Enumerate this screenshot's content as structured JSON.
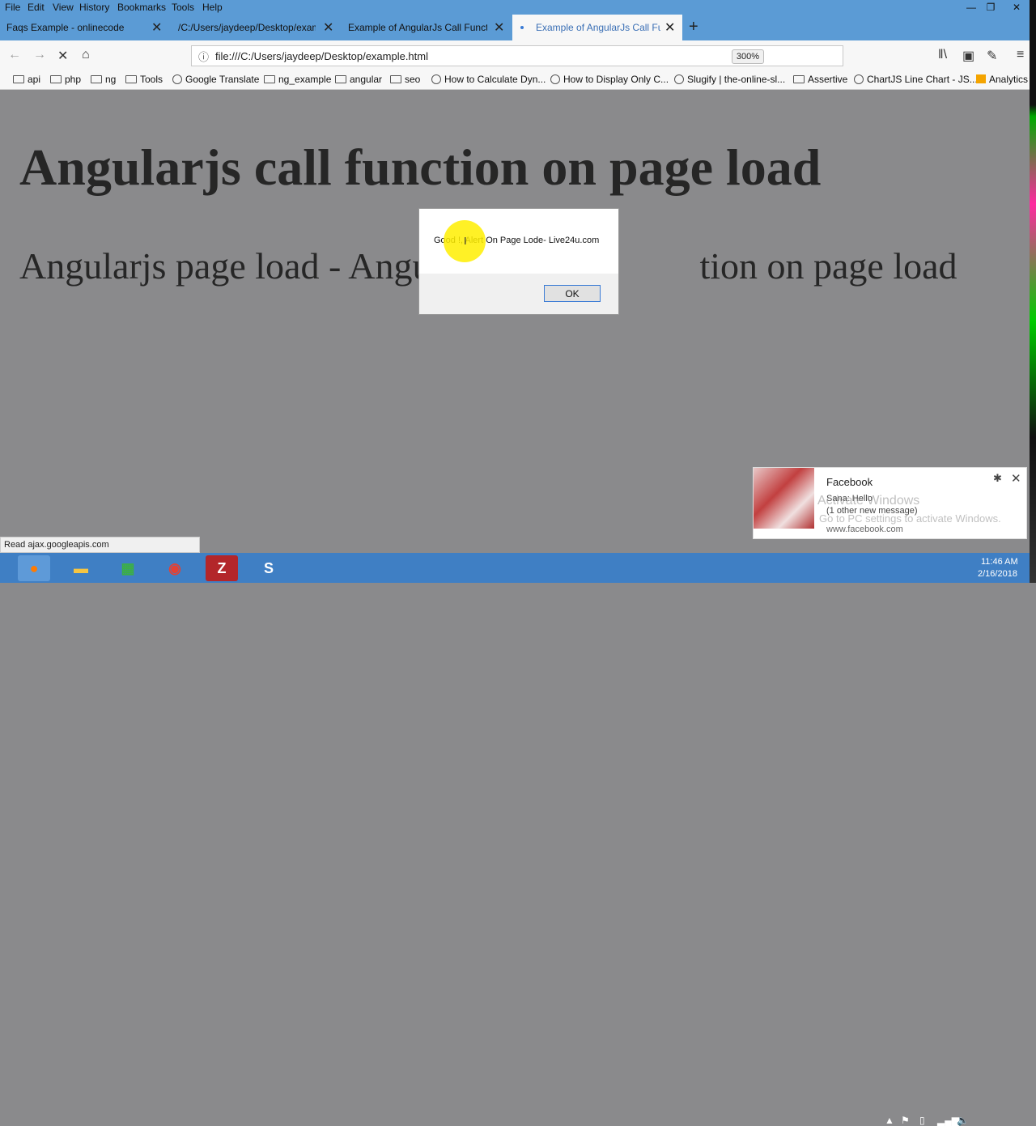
{
  "menu": {
    "items": [
      "File",
      "Edit",
      "View",
      "History",
      "Bookmarks",
      "Tools",
      "Help"
    ]
  },
  "tabs": [
    {
      "label": "Faqs Example - onlinecode"
    },
    {
      "label": "/C:/Users/jaydeep/Desktop/examp"
    },
    {
      "label": "Example of AngularJs Call Function"
    },
    {
      "label": "Example of AngularJs Call Func"
    }
  ],
  "toolbar": {
    "url": "file:///C:/Users/jaydeep/Desktop/example.html",
    "zoom": "300%"
  },
  "bookmarks": [
    "api",
    "php",
    "ng",
    "Tools",
    "Google Translate",
    "ng_example",
    "angular",
    "seo",
    "How to Calculate Dyn...",
    "How to Display Only C...",
    "Slugify | the-online-sl...",
    "Assertive",
    "ChartJS Line Chart - JS...",
    "Analytics"
  ],
  "page": {
    "heading": "Angularjs call function on page load",
    "subheading_left": "Angularjs page load - Angu",
    "subheading_right": "tion on page load"
  },
  "alert": {
    "message": "Good !, Alert On Page Lode- Live24u.com",
    "ok_label": "OK"
  },
  "status": {
    "text": "Read ajax.googleapis.com"
  },
  "notification": {
    "title": "Facebook",
    "line1": "Sana: Hello",
    "line2": "(1 other new message)",
    "url": "www.facebook.com"
  },
  "watermark": {
    "line1": "Activate Windows",
    "line2": "Go to PC settings to activate Windows."
  },
  "clock": {
    "time": "11:46 AM",
    "date": "2/16/2018"
  },
  "colors": {
    "tabbar": "#5b9bd5",
    "taskbar": "#3f7fc4",
    "overlay": "#8a8a8c"
  }
}
